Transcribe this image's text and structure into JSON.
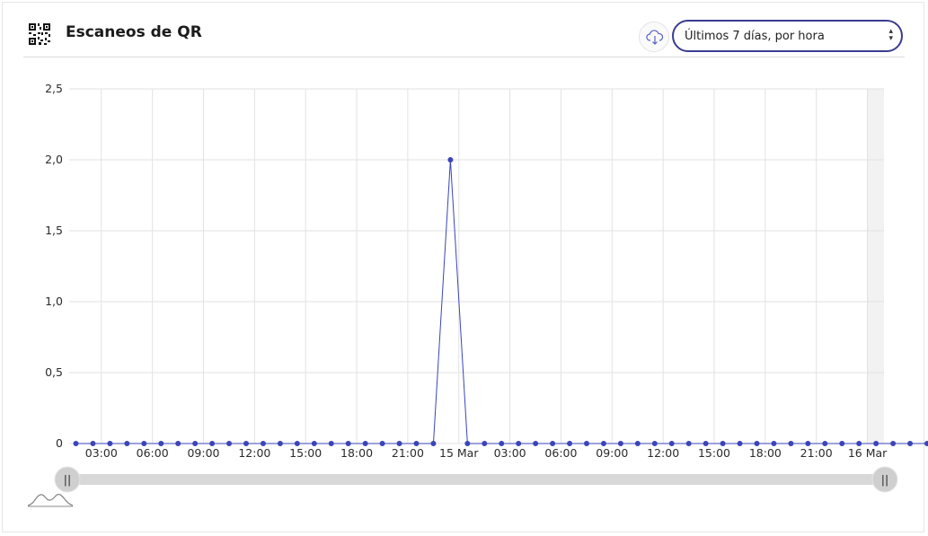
{
  "header": {
    "title": "Escaneos de QR",
    "range_select": "Últimos 7 días, por hora",
    "select_caret": "⌃⌄"
  },
  "colors": {
    "series": "#3a45b8",
    "select_border": "#3a3d8f",
    "grid": "#e2e2e2",
    "navigator_track": "#d8d8d8"
  },
  "icons": {
    "qr": "qr-code-icon",
    "download": "cloud-download-icon",
    "navigator": "navigator-area-icon"
  },
  "chart_data": {
    "type": "line",
    "title": "",
    "xlabel": "",
    "ylabel": "",
    "ylim": [
      0,
      2.5
    ],
    "y_ticks": [
      "0",
      "0,5",
      "1,0",
      "1,5",
      "2,0",
      "2,5"
    ],
    "x_ticks": [
      "03:00",
      "06:00",
      "09:00",
      "12:00",
      "15:00",
      "18:00",
      "21:00",
      "15 Mar",
      "03:00",
      "06:00",
      "09:00",
      "12:00",
      "15:00",
      "18:00",
      "21:00",
      "16 Mar"
    ],
    "grid": true,
    "legend": "none",
    "series": [
      {
        "values": [
          0,
          0,
          0,
          0,
          0,
          0,
          0,
          0,
          0,
          0,
          0,
          0,
          0,
          0,
          0,
          0,
          0,
          0,
          0,
          0,
          0,
          0,
          2,
          0,
          0,
          0,
          0,
          0,
          0,
          0,
          0,
          0,
          0,
          0,
          0,
          0,
          0,
          0,
          0,
          0,
          0,
          0,
          0,
          0,
          0,
          0,
          0,
          0,
          0,
          0,
          0
        ]
      }
    ]
  },
  "navigator": {
    "left_handle": "||",
    "right_handle": "||"
  }
}
